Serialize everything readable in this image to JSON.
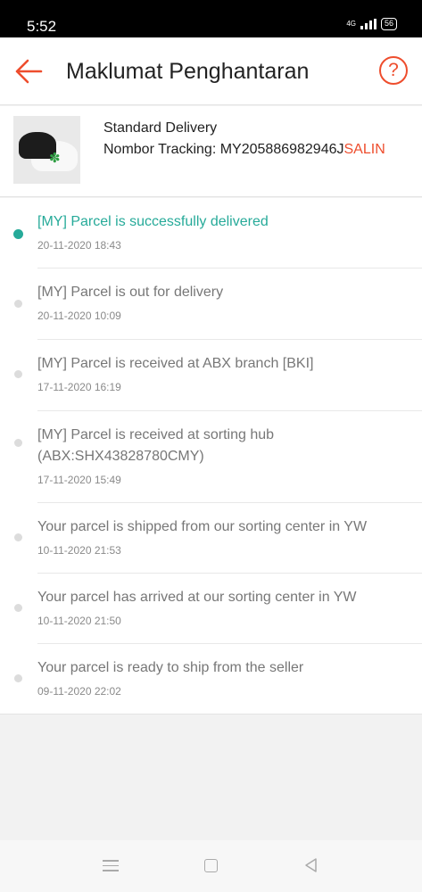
{
  "status_bar": {
    "time": "5:52",
    "network": "4G",
    "battery": "56"
  },
  "header": {
    "title": "Maklumat Penghantaran",
    "back_icon": "arrow-left-icon",
    "help_icon": "help-circle-icon",
    "help_symbol": "?"
  },
  "delivery": {
    "type": "Standard Delivery",
    "tracking_label": "Nombor Tracking:",
    "tracking_number": "MY205886982946J",
    "copy_label": "SALIN"
  },
  "events": [
    {
      "text": "[MY] Parcel is successfully delivered",
      "time": "20-11-2020 18:43"
    },
    {
      "text": "[MY] Parcel is out for delivery",
      "time": "20-11-2020 10:09"
    },
    {
      "text": "[MY] Parcel is received at ABX branch [BKI]",
      "time": "17-11-2020 16:19"
    },
    {
      "text": "[MY] Parcel is received at sorting hub (ABX:SHX43828780CMY)",
      "time": "17-11-2020 15:49"
    },
    {
      "text": "Your parcel is shipped from our sorting center in YW",
      "time": "10-11-2020 21:53"
    },
    {
      "text": "Your parcel has arrived at our sorting center in YW",
      "time": "10-11-2020 21:50"
    },
    {
      "text": "Your parcel is ready to ship from the seller",
      "time": "09-11-2020 22:02"
    }
  ],
  "colors": {
    "accent": "#ee4d2d",
    "delivered": "#26aa99"
  }
}
